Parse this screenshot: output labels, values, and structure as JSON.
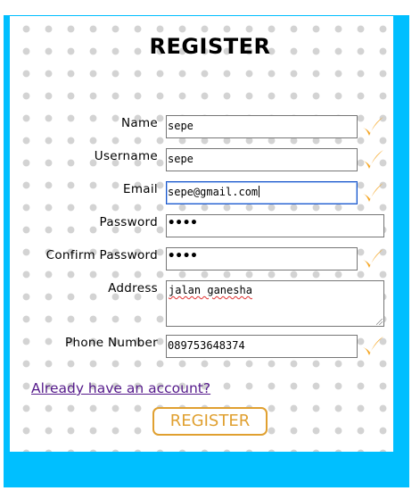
{
  "form": {
    "title": "REGISTER",
    "fields": {
      "name": {
        "label": "Name",
        "value": "sepe",
        "valid": true
      },
      "username": {
        "label": "Username",
        "value": "sepe",
        "valid": true
      },
      "email": {
        "label": "Email",
        "value": "sepe@gmail.com",
        "valid": true
      },
      "password": {
        "label": "Password",
        "value": "••••",
        "valid": false
      },
      "confirm_password": {
        "label": "Confirm Password",
        "value": "••••",
        "valid": true
      },
      "address": {
        "label": "Address",
        "value": "jalan ganesha"
      },
      "phone": {
        "label": "Phone Number",
        "value": "089753648374",
        "valid": true
      }
    },
    "login_link": "Already have an account?",
    "submit_label": "REGISTER"
  },
  "colors": {
    "frame": "#00bfff",
    "check": "#f5a623",
    "button_accent": "#e0a030",
    "link": "#551a8b"
  },
  "icons": {
    "check": "orange-check-icon"
  }
}
